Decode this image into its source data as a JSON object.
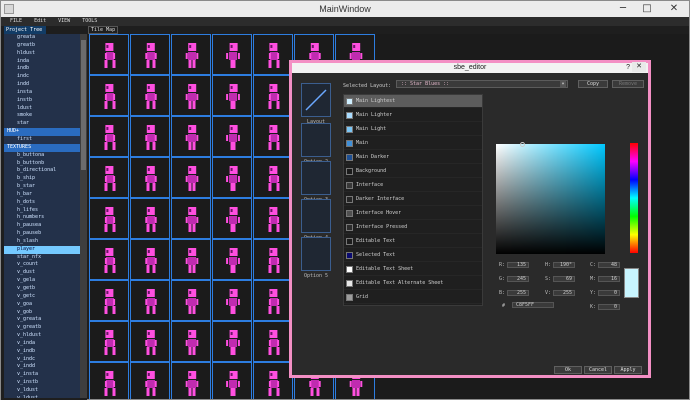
{
  "window": {
    "title": "MainWindow",
    "min": "─",
    "max": "□",
    "close": "✕"
  },
  "menu": [
    "FILE",
    "Edit",
    "VIEW",
    "TOOLS"
  ],
  "left_panel": {
    "tab": "Project Tree",
    "tree": [
      {
        "label": "greata",
        "kind": "item"
      },
      {
        "label": "greatb",
        "kind": "item"
      },
      {
        "label": "hldust",
        "kind": "item"
      },
      {
        "label": "inda",
        "kind": "item"
      },
      {
        "label": "indb",
        "kind": "item"
      },
      {
        "label": "indc",
        "kind": "item"
      },
      {
        "label": "indd",
        "kind": "item"
      },
      {
        "label": "insta",
        "kind": "item"
      },
      {
        "label": "instb",
        "kind": "item"
      },
      {
        "label": "ldust",
        "kind": "item"
      },
      {
        "label": "smoke",
        "kind": "item"
      },
      {
        "label": "star",
        "kind": "item"
      },
      {
        "label": "HUD+",
        "kind": "section"
      },
      {
        "label": "first",
        "kind": "item"
      },
      {
        "label": "TEXTURES",
        "kind": "section"
      },
      {
        "label": "b_buttona",
        "kind": "item"
      },
      {
        "label": "b_buttonb",
        "kind": "item"
      },
      {
        "label": "b_directional",
        "kind": "item"
      },
      {
        "label": "b_ship",
        "kind": "item"
      },
      {
        "label": "b_star",
        "kind": "item"
      },
      {
        "label": "h_bar",
        "kind": "item"
      },
      {
        "label": "h_dots",
        "kind": "item"
      },
      {
        "label": "h_lifes",
        "kind": "item"
      },
      {
        "label": "h_numbers",
        "kind": "item"
      },
      {
        "label": "h_pausea",
        "kind": "item"
      },
      {
        "label": "h_pauseb",
        "kind": "item"
      },
      {
        "label": "h_slash",
        "kind": "item"
      },
      {
        "label": "player",
        "kind": "selected"
      },
      {
        "label": "star_nfx",
        "kind": "item"
      },
      {
        "label": "v_count",
        "kind": "item"
      },
      {
        "label": "v_dust",
        "kind": "item"
      },
      {
        "label": "v_gela",
        "kind": "item"
      },
      {
        "label": "v_getb",
        "kind": "item"
      },
      {
        "label": "v_getc",
        "kind": "item"
      },
      {
        "label": "v_goa",
        "kind": "item"
      },
      {
        "label": "v_gob",
        "kind": "item"
      },
      {
        "label": "v_greata",
        "kind": "item"
      },
      {
        "label": "v_greatb",
        "kind": "item"
      },
      {
        "label": "v_hldust",
        "kind": "item"
      },
      {
        "label": "v_inda",
        "kind": "item"
      },
      {
        "label": "v_indb",
        "kind": "item"
      },
      {
        "label": "v_indc",
        "kind": "item"
      },
      {
        "label": "v_indd",
        "kind": "item"
      },
      {
        "label": "v_insta",
        "kind": "item"
      },
      {
        "label": "v_instb",
        "kind": "item"
      },
      {
        "label": "v_ldust",
        "kind": "item"
      },
      {
        "label": "v_ldust",
        "kind": "item"
      },
      {
        "label": "v_smoke",
        "kind": "item"
      }
    ]
  },
  "tilemap": {
    "tab": "Tile Map",
    "rows": 9,
    "cols": 7,
    "sprite_colors": [
      "#ff4fe0",
      "#c02bb0",
      "#6a1466"
    ]
  },
  "dialog": {
    "title": "sbe_editor",
    "help": "?",
    "close": "✕",
    "options": [
      "Layout",
      "Option 2",
      "Option 3",
      "Option 4",
      "Option 5"
    ],
    "selected_layout_label": "Selected Layout:",
    "selected_layout_value": ":: Star Blues ::",
    "copy_btn": "Copy",
    "remove_btn": "Remove",
    "colors": [
      {
        "label": "Main Lightest",
        "hex": "#cfefff",
        "selected": true
      },
      {
        "label": "Main Lighter",
        "hex": "#a9dcff"
      },
      {
        "label": "Main Light",
        "hex": "#7ac5f5"
      },
      {
        "label": "Main",
        "hex": "#3f8fd8"
      },
      {
        "label": "Main Darker",
        "hex": "#1d4f94"
      },
      {
        "label": "Background",
        "hex": "#1a1a1a"
      },
      {
        "label": "Interface",
        "hex": "#383838"
      },
      {
        "label": "Darker Interface",
        "hex": "#262626"
      },
      {
        "label": "Interface Hover",
        "hex": "#505050"
      },
      {
        "label": "Interface Pressed",
        "hex": "#2c2c2c"
      },
      {
        "label": "Editable Text",
        "hex": "#1c1c1c"
      },
      {
        "label": "Selected Text",
        "hex": "#0a0a70"
      },
      {
        "label": "Editable Text Sheet",
        "hex": "#ffffff"
      },
      {
        "label": "Editable Text Alternate Sheet",
        "hex": "#e8e8e8"
      },
      {
        "label": "Grid",
        "hex": "#9c9c9c"
      }
    ],
    "fields": {
      "R": "135",
      "G": "245",
      "B": "255",
      "H": "190°",
      "S": "69",
      "V": "255",
      "C": "48",
      "M": "16",
      "Y": "0",
      "K": "0",
      "hex_label": "#",
      "hex": "C8F5FF"
    },
    "ok": "Ok",
    "cancel": "Cancel",
    "apply": "Apply"
  }
}
